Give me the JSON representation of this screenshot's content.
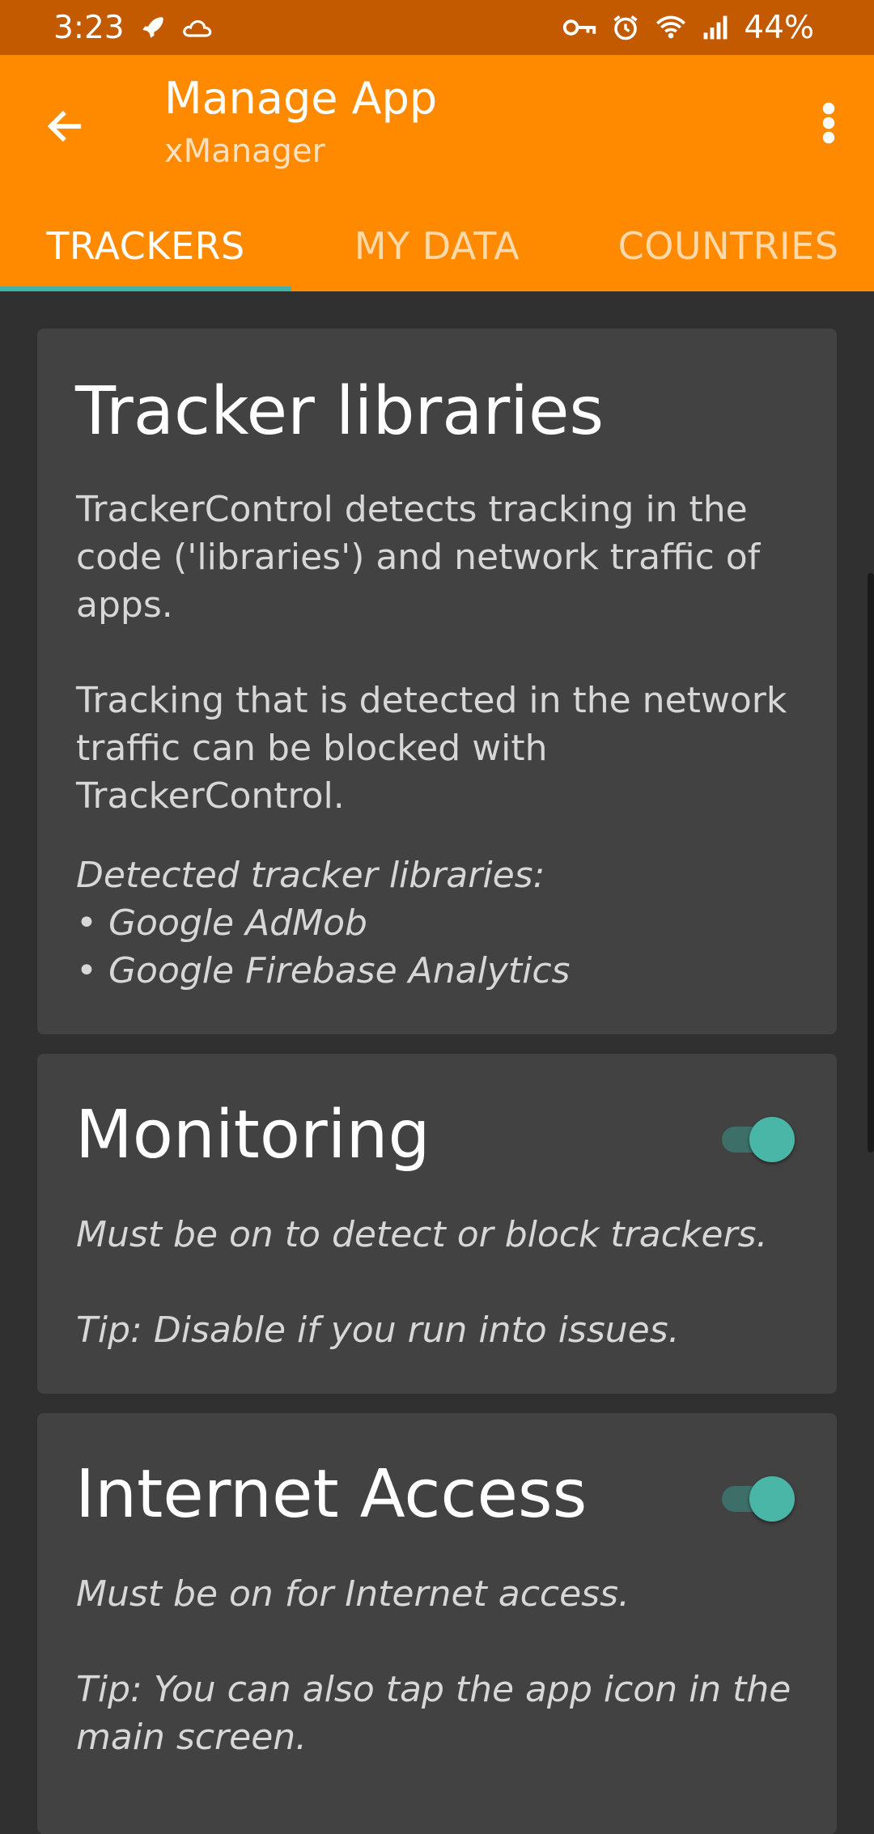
{
  "status_bar": {
    "time": "3:23",
    "battery": "44%",
    "icons_left": [
      "rocket-icon",
      "cloud-icon"
    ],
    "icons_right": [
      "vpn-key-icon",
      "alarm-icon",
      "wifi-icon",
      "signal-icon"
    ]
  },
  "app_bar": {
    "title": "Manage App",
    "subtitle": "xManager",
    "back_icon": "arrow-left-icon",
    "overflow_icon": "more-vert-icon",
    "color": "#ff8a00"
  },
  "tabs": [
    {
      "label": "TRACKERS",
      "active": true
    },
    {
      "label": "MY DATA",
      "active": false
    },
    {
      "label": "COUNTRIES",
      "active": false
    }
  ],
  "tracker_libraries": {
    "title": "Tracker libraries",
    "paragraph1": "TrackerControl detects tracking in the code ('libraries') and network traffic of apps.",
    "paragraph2": "Tracking that is detected in the network traffic can be blocked with TrackerControl.",
    "detected_heading": "Detected tracker libraries:",
    "detected": [
      "• Google AdMob",
      "• Google Firebase Analytics"
    ]
  },
  "monitoring": {
    "title": "Monitoring",
    "enabled": true,
    "line1": "Must be on to detect or block trackers.",
    "line2": "Tip: Disable if you run into issues."
  },
  "internet_access": {
    "title": "Internet Access",
    "enabled": true,
    "line1": "Must be on for Internet access.",
    "line2": "Tip: You can also tap the app icon in the main screen."
  },
  "colors": {
    "status_bar": "#c35a00",
    "accent": "#4ab6a7",
    "background": "#303030",
    "card": "#424242"
  }
}
